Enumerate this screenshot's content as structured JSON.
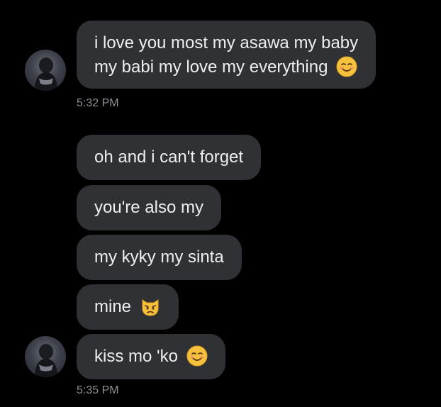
{
  "conversation": {
    "groups": [
      {
        "messages": [
          {
            "lines": [
              "i love you most my asawa my baby",
              "my babi my love my everything"
            ],
            "emoji": "smiling-face-icon"
          }
        ],
        "timestamp": "5:32 PM"
      },
      {
        "messages": [
          {
            "text": "oh and i can't forget"
          },
          {
            "text": "you're also my"
          },
          {
            "text": "my kyky my sinta"
          },
          {
            "text": "mine",
            "emoji": "pouting-cat-icon"
          },
          {
            "text": "kiss mo 'ko",
            "emoji": "smiling-face-icon"
          }
        ],
        "timestamp": "5:35 PM"
      }
    ]
  },
  "colors": {
    "background": "#000000",
    "bubble": "#2f3135",
    "text": "#eceff1",
    "timestamp": "#8e9096"
  }
}
